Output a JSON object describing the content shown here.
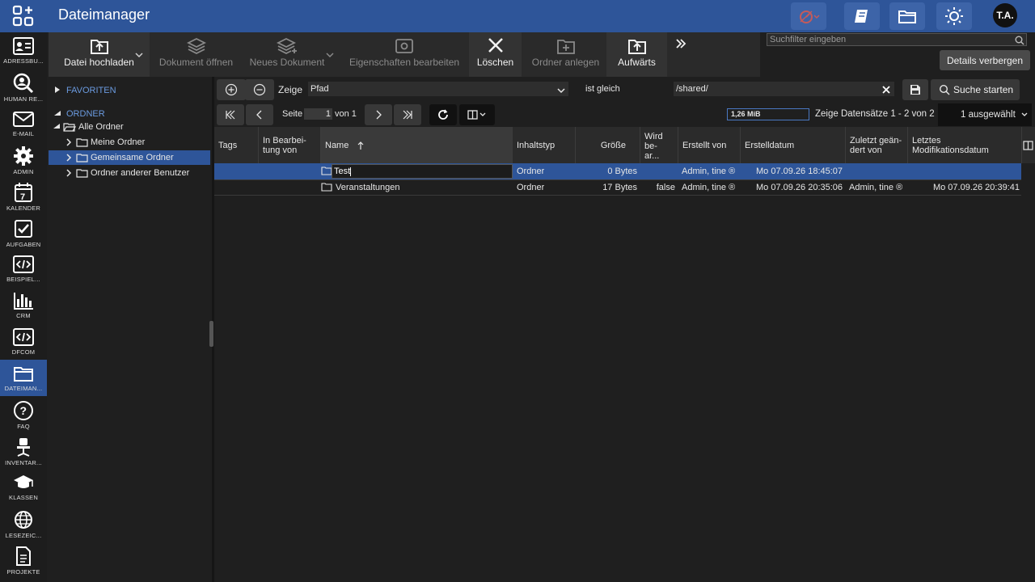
{
  "app": {
    "title": "Dateimanager",
    "user_initials": "T.A."
  },
  "left_nav": [
    {
      "label": "ADRESSBU...",
      "icon": "address-book-icon"
    },
    {
      "label": "HUMAN RE...",
      "icon": "user-search-icon"
    },
    {
      "label": "E-MAIL",
      "icon": "mail-icon"
    },
    {
      "label": "ADMIN",
      "icon": "gear-icon"
    },
    {
      "label": "KALENDER",
      "icon": "calendar-icon"
    },
    {
      "label": "AUFGABEN",
      "icon": "checkbox-icon"
    },
    {
      "label": "BEISPIEL...",
      "icon": "code-icon"
    },
    {
      "label": "CRM",
      "icon": "bar-chart-icon"
    },
    {
      "label": "DFCOM",
      "icon": "code-icon"
    },
    {
      "label": "DATEIMAN...",
      "icon": "folder-open-icon"
    },
    {
      "label": "FAQ",
      "icon": "help-icon"
    },
    {
      "label": "INVENTAR...",
      "icon": "chair-icon"
    },
    {
      "label": "KLASSEN",
      "icon": "graduation-cap-icon"
    },
    {
      "label": "LESEZEIC...",
      "icon": "globe-icon"
    },
    {
      "label": "PROJEKTE",
      "icon": "document-icon"
    }
  ],
  "toolbar": {
    "upload": "Datei hochladen",
    "open_doc": "Dokument öffnen",
    "new_doc": "Neues Dokument",
    "edit_props": "Eigenschaften bearbeiten",
    "delete": "Löschen",
    "new_folder": "Ordner anlegen",
    "up": "Aufwärts"
  },
  "search": {
    "placeholder": "Suchfilter eingeben"
  },
  "details_button": "Details verbergen",
  "tree": {
    "favorites": "FAVORITEN",
    "folders": "ORDNER",
    "all": "Alle Ordner",
    "mine": "Meine Ordner",
    "shared": "Gemeinsame Ordner",
    "others": "Ordner anderer Benutzer"
  },
  "filter": {
    "show_label": "Zeige",
    "field": "Pfad",
    "operator": "ist gleich",
    "value": "/shared/",
    "search_button": "Suche starten"
  },
  "pager": {
    "page_label": "Seite",
    "page": "1",
    "of": "von 1",
    "memory": "1,26 MiB",
    "records": "Zeige Datensätze 1 - 2 von 2",
    "selected": "1 ausgewählt"
  },
  "columns": {
    "tags": "Tags",
    "editing_by": "In Bearbei- tung von",
    "name": "Name",
    "type": "Inhaltstyp",
    "size": "Größe",
    "being_edited": "Wird be- ar...",
    "created_by": "Erstellt von",
    "created_date": "Erstelldatum",
    "modified_by": "Zuletzt geän- dert von",
    "modified_date": "Letztes Modifikationsdatum"
  },
  "rows": [
    {
      "name": "Test",
      "type": "Ordner",
      "size": "0 Bytes",
      "being_edited": "",
      "created_by": "Admin, tine ®",
      "created": "Mo 07.09.26 18:45:07",
      "modified_by": "",
      "modified": ""
    },
    {
      "name": "Veranstaltungen",
      "type": "Ordner",
      "size": "17 Bytes",
      "being_edited": "false",
      "created_by": "Admin, tine ®",
      "created": "Mo 07.09.26 20:35:06",
      "modified_by": "Admin, tine ®",
      "modified": "Mo 07.09.26 20:39:41"
    }
  ],
  "colors": {
    "accent": "#2e5599",
    "background": "#1f1f1f"
  }
}
